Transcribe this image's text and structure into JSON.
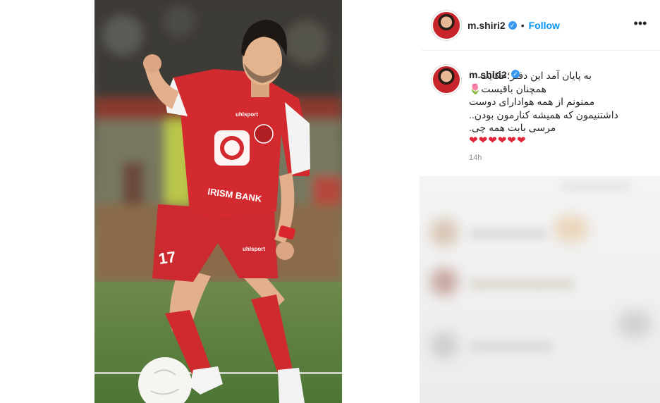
{
  "post": {
    "username": "m.shiri2",
    "verified_icon": "verified-badge-icon",
    "separator": "•",
    "follow_label": "Follow",
    "more_icon": "more-options-icon",
    "more_glyph": "•••"
  },
  "photo": {
    "jersey_sponsor": "IRISM BANK",
    "shirt_brand": "uhlsport",
    "shirt_number": "17"
  },
  "caption": {
    "username": "m.shiri2",
    "line1": "به پایان آمد این دفتر؛حکایت",
    "line2": "همچنان باقیست🌷",
    "line3": "ممنونم از همه هوادارای دوست",
    "line4": "داشتنیمون که همیشه کنارمون بودن..",
    "line5": "مرسی بابت همه چی.",
    "hearts": "❤❤❤❤❤❤",
    "time": "14h"
  },
  "colors": {
    "accent": "#0095f6",
    "verified": "#3897f0",
    "jersey_red": "#d32a2f",
    "heart": "#e0263a"
  }
}
